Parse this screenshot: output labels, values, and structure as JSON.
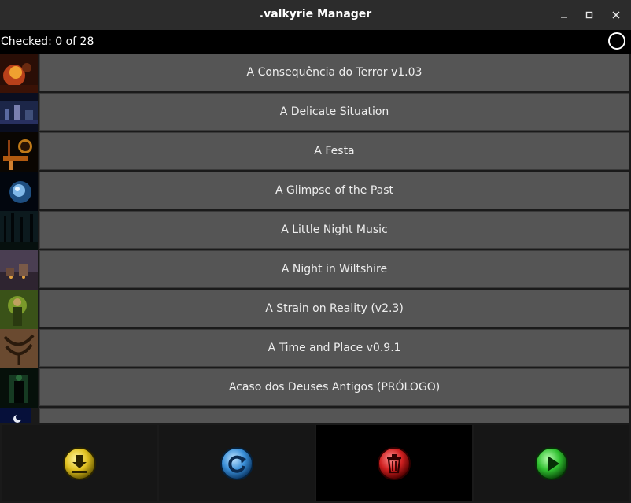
{
  "window": {
    "title": ".valkyrie Manager",
    "minimize_glyph": "—",
    "maximize_glyph": "□",
    "close_glyph": "✕"
  },
  "status": {
    "checked_label": "Checked: 0 of 28"
  },
  "scenarios": [
    {
      "label": "A Consequência do Terror v1.03",
      "thumb": "fire-scene"
    },
    {
      "label": "A Delicate Situation",
      "thumb": "town-night"
    },
    {
      "label": "A Festa",
      "thumb": "clock-sign"
    },
    {
      "label": "A Glimpse of the Past",
      "thumb": "crystal-orb"
    },
    {
      "label": "A Little Night Music",
      "thumb": "dark-forest"
    },
    {
      "label": "A Night in Wiltshire",
      "thumb": "foggy-village"
    },
    {
      "label": "A Strain on Reality (v2.3)",
      "thumb": "green-figure"
    },
    {
      "label": "A Time and Place v0.9.1",
      "thumb": "winged-emblem"
    },
    {
      "label": "Acaso dos Deuses Antigos (PRÓLOGO)",
      "thumb": "green-doorway"
    },
    {
      "label": "",
      "thumb": "moon-night"
    }
  ],
  "actions": [
    {
      "name": "download-icon",
      "color": "#e0c020"
    },
    {
      "name": "refresh-icon",
      "color": "#3a8fd8"
    },
    {
      "name": "delete-icon",
      "color": "#d02020"
    },
    {
      "name": "play-icon",
      "color": "#30c030"
    }
  ]
}
